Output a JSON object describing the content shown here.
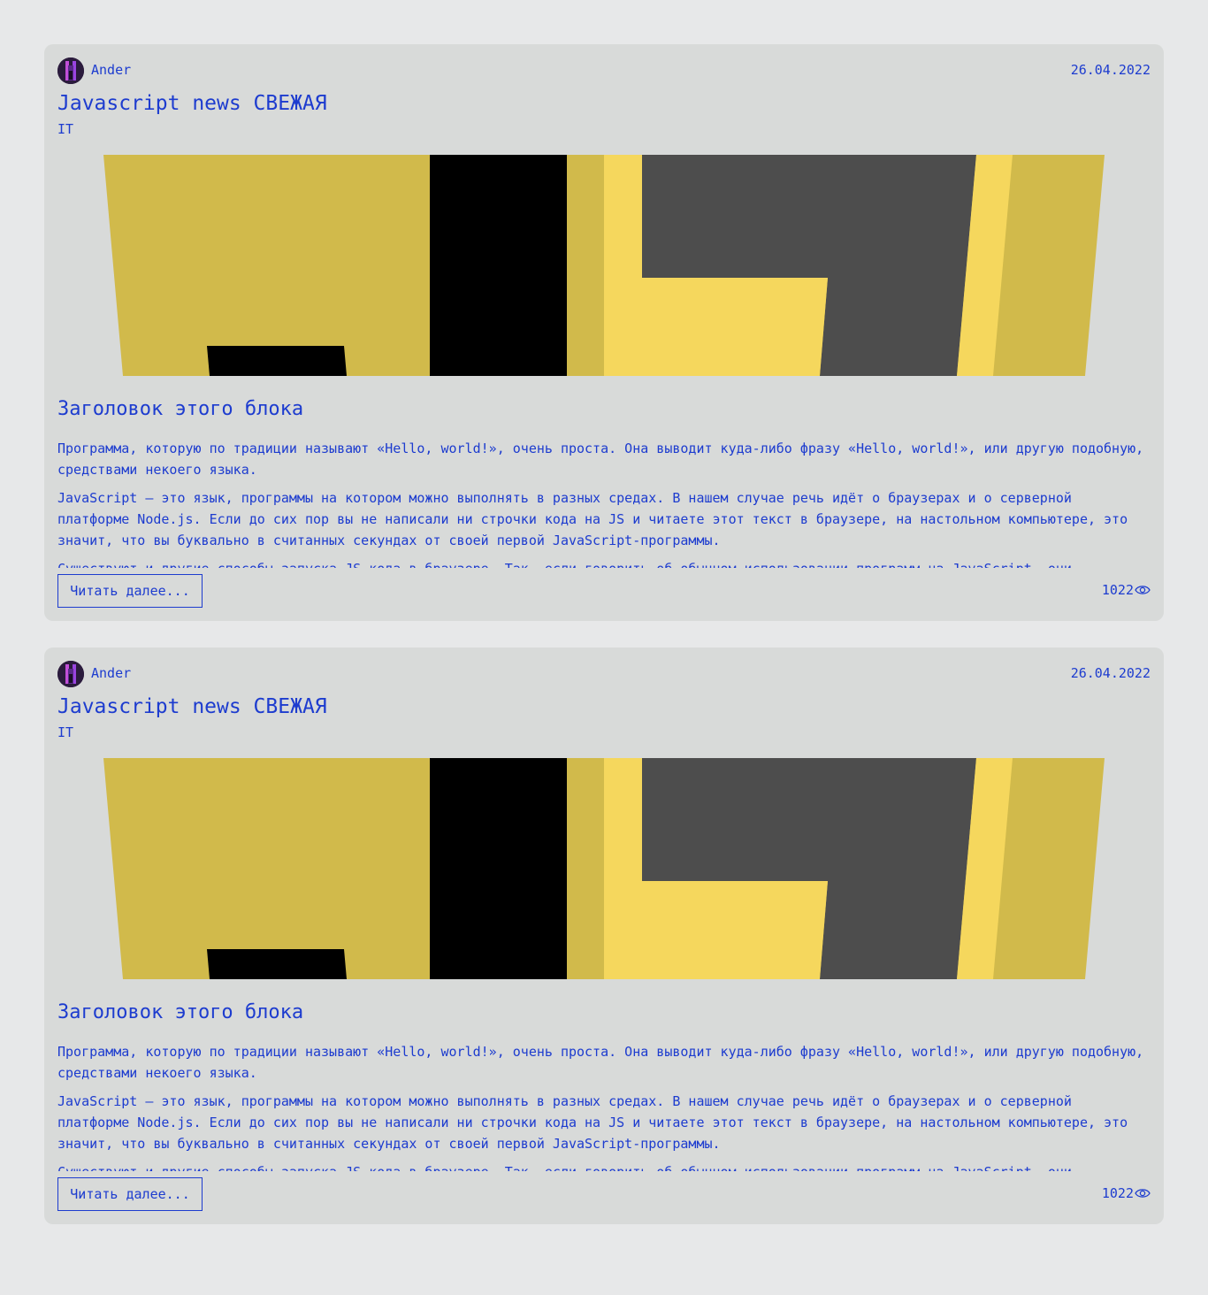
{
  "colors": {
    "page_bg": "#e7e8e9",
    "card_bg": "#d8dad9",
    "text": "#1d3ccf",
    "image_gold": "#d1ba4b",
    "image_yellow": "#f5d75d",
    "image_dark": "#4d4d4d",
    "image_black": "#000000"
  },
  "posts": [
    {
      "author": "Ander",
      "date": "26.04.2022",
      "title": "Javascript news СВЕЖАЯ",
      "category": "IT",
      "subtitle": "Заголовок этого блока",
      "paragraphs": [
        "Программа, которую по традиции называют «Hello, world!», очень проста. Она выводит куда-либо фразу «Hello, world!», или другую подобную, средствами некоего языка.",
        "JavaScript — это язык, программы на котором можно выполнять в разных средах. В нашем случае речь идёт о браузерах и о серверной платформе Node.js. Если до сих пор вы не написали ни строчки кода на JS и читаете этот текст в браузере, на настольном компьютере, это значит, что вы буквально в считанных секундах от своей первой JavaScript-программы.",
        "Существуют и другие способы запуска JS-кода в браузере. Так, если говорить об обычном использовании программ на JavaScript, они загружаются"
      ],
      "read_more_label": "Читать далее...",
      "views": "1022",
      "views_icon": "eye-icon"
    },
    {
      "author": "Ander",
      "date": "26.04.2022",
      "title": "Javascript news СВЕЖАЯ",
      "category": "IT",
      "subtitle": "Заголовок этого блока",
      "paragraphs": [
        "Программа, которую по традиции называют «Hello, world!», очень проста. Она выводит куда-либо фразу «Hello, world!», или другую подобную, средствами некоего языка.",
        "JavaScript — это язык, программы на котором можно выполнять в разных средах. В нашем случае речь идёт о браузерах и о серверной платформе Node.js. Если до сих пор вы не написали ни строчки кода на JS и читаете этот текст в браузере, на настольном компьютере, это значит, что вы буквально в считанных секундах от своей первой JavaScript-программы.",
        "Существуют и другие способы запуска JS-кода в браузере. Так, если говорить об обычном использовании программ на JavaScript, они загружаются"
      ],
      "read_more_label": "Читать далее...",
      "views": "1022",
      "views_icon": "eye-icon"
    }
  ]
}
